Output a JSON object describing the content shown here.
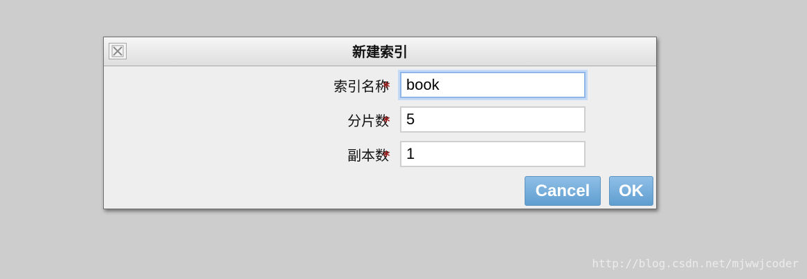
{
  "dialog": {
    "title": "新建索引",
    "close_icon": "close-icon"
  },
  "form": {
    "fields": [
      {
        "label": "索引名称",
        "required_mark": "*",
        "value": "book",
        "focused": true
      },
      {
        "label": "分片数",
        "required_mark": "*",
        "value": "5",
        "focused": false
      },
      {
        "label": "副本数",
        "required_mark": "*",
        "value": "1",
        "focused": false
      }
    ]
  },
  "buttons": {
    "cancel_label": "Cancel",
    "ok_label": "OK"
  },
  "watermark": "http://blog.csdn.net/mjwwjcoder",
  "colors": {
    "background": "#cdcdcd",
    "dialog": "#eeeeee",
    "required": "#9c1c1c",
    "button": "#6fa8d8",
    "focus": "#8fb5e9"
  }
}
